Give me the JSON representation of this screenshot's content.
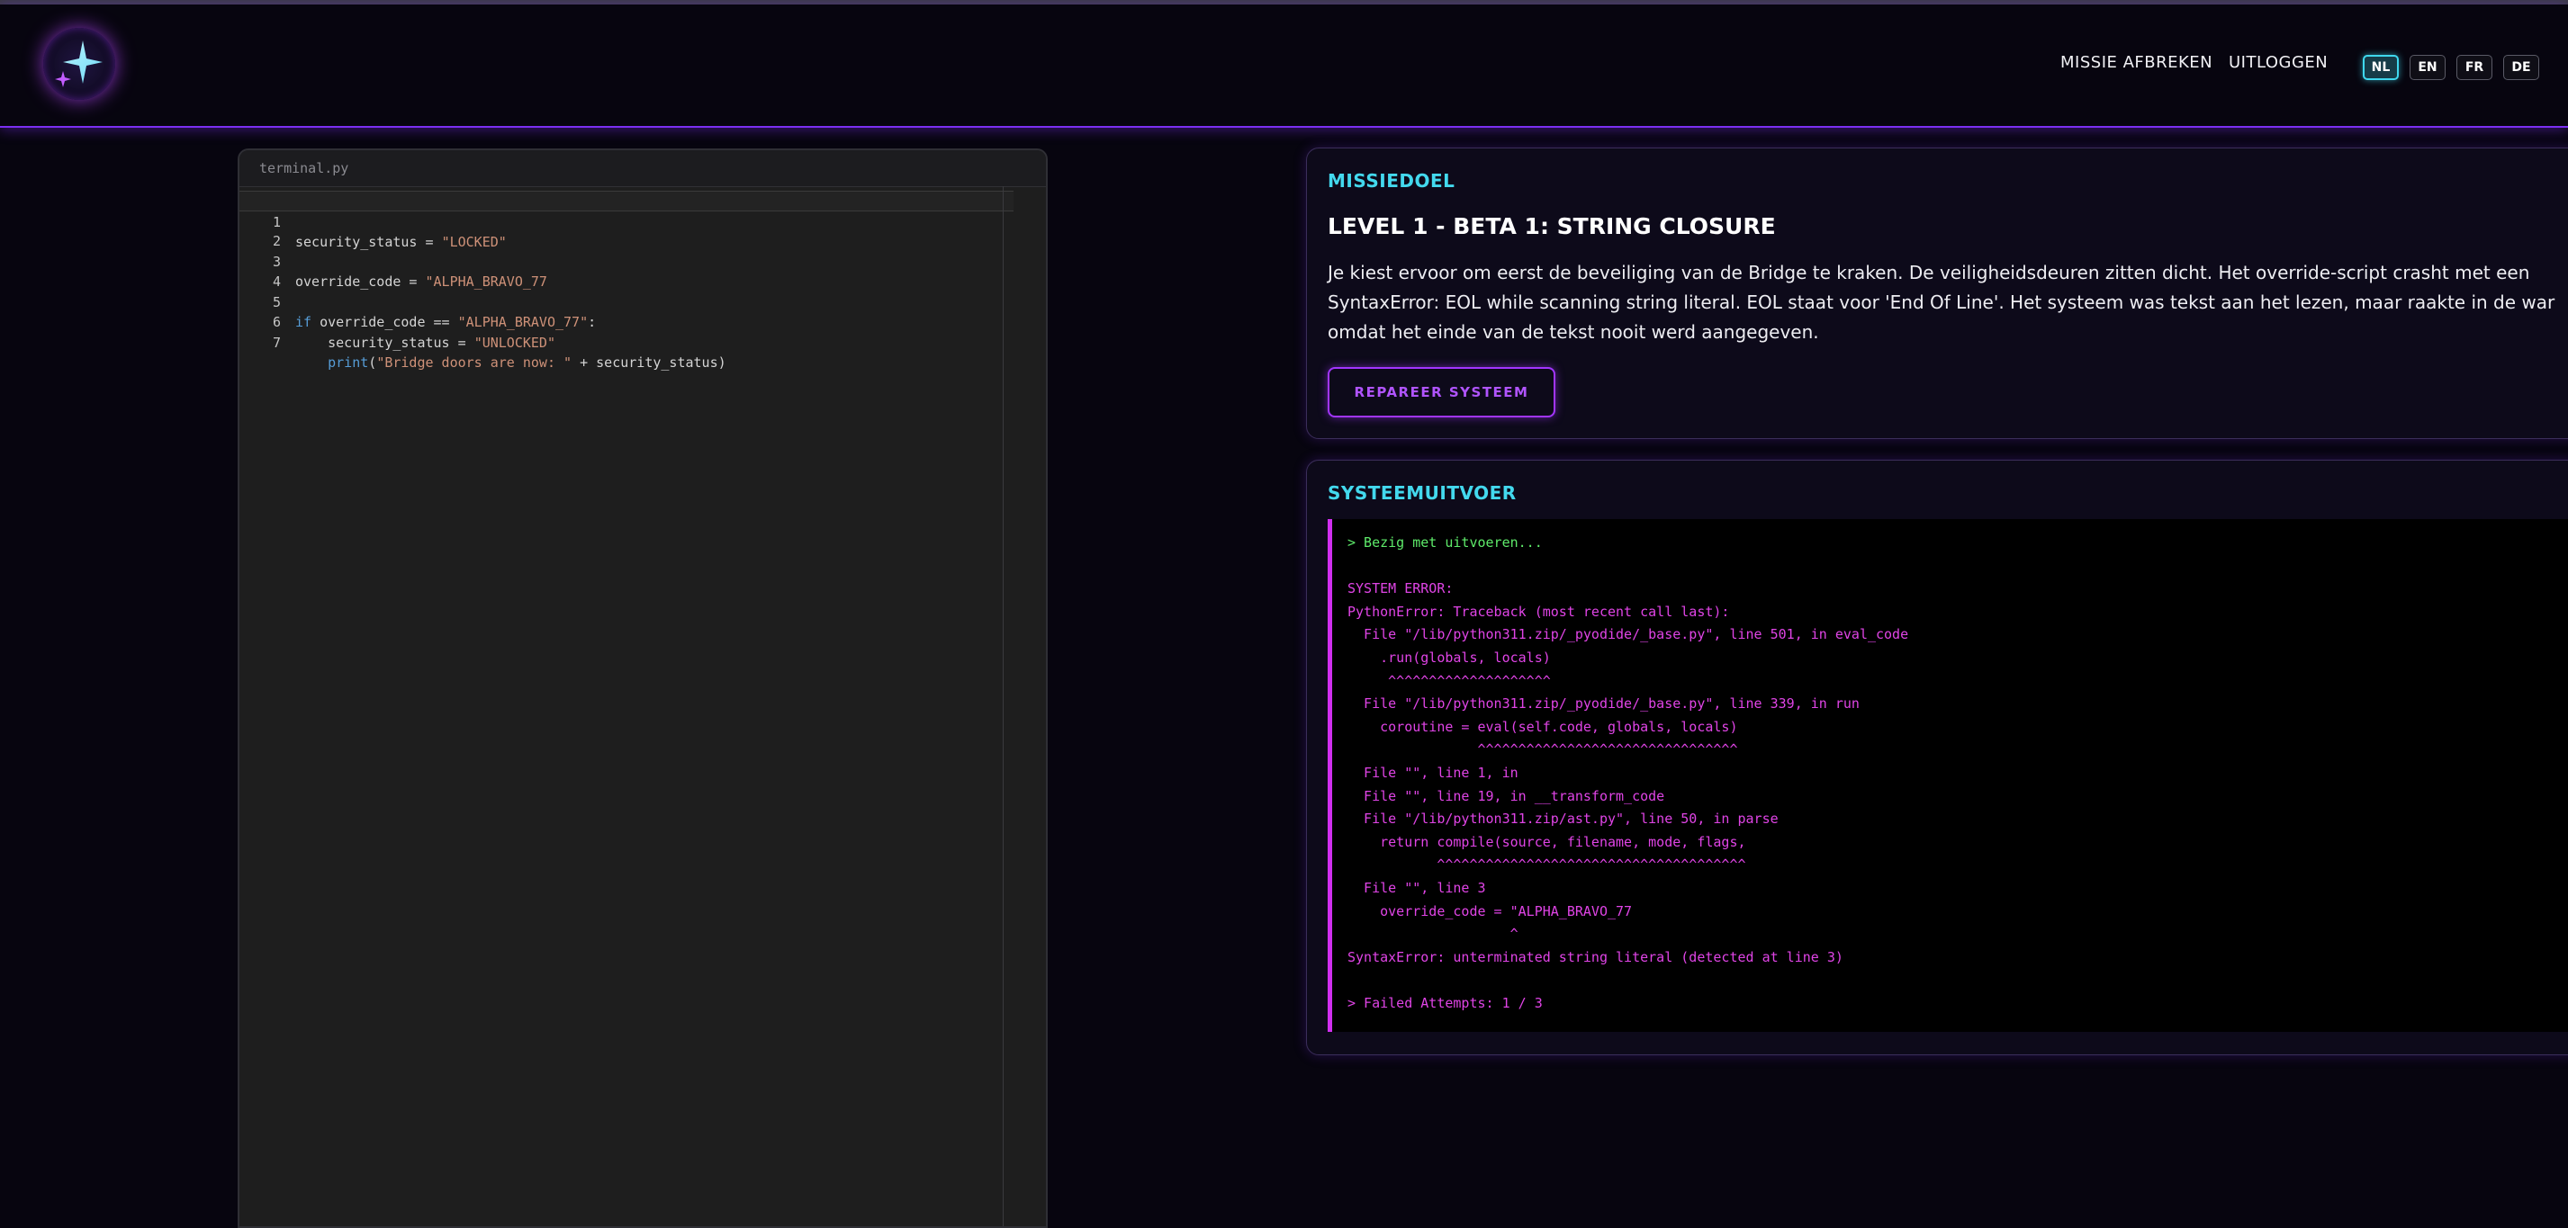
{
  "header": {
    "logo_icon": "sparkle-star-icon",
    "nav": {
      "abort": "MISSIE AFBREKEN",
      "logout": "UITLOGGEN"
    },
    "languages": [
      {
        "code": "NL",
        "active": true
      },
      {
        "code": "EN",
        "active": false
      },
      {
        "code": "FR",
        "active": false
      },
      {
        "code": "DE",
        "active": false
      }
    ]
  },
  "editor": {
    "filename": "terminal.py",
    "lines": [
      {
        "num": "1",
        "text": "security_status = \"LOCKED\""
      },
      {
        "num": "2",
        "text": ""
      },
      {
        "num": "3",
        "text": "override_code = \"ALPHA_BRAVO_77"
      },
      {
        "num": "4",
        "text": ""
      },
      {
        "num": "5",
        "text": "if override_code == \"ALPHA_BRAVO_77\":"
      },
      {
        "num": "6",
        "text": "    security_status = \"UNLOCKED\""
      },
      {
        "num": "7",
        "text": "    print(\"Bridge doors are now: \" + security_status)"
      }
    ]
  },
  "mission": {
    "title": "MISSIEDOEL",
    "level": "LEVEL 1 - BETA 1: STRING CLOSURE",
    "description": "Je kiest ervoor om eerst de beveiliging van de Bridge te kraken. De veiligheidsdeuren zitten dicht. Het override-script crasht met een SyntaxError: EOL while scanning string literal. EOL staat voor 'End Of Line'. Het systeem was tekst aan het lezen, maar raakte in de war omdat het einde van de tekst nooit werd aangegeven.",
    "button": "REPAREER SYSTEEM"
  },
  "output": {
    "title": "SYSTEEMUITVOER",
    "lines": [
      {
        "text": "> Bezig met uitvoeren...",
        "kind": "ok"
      },
      {
        "text": "",
        "kind": "err"
      },
      {
        "text": "SYSTEM ERROR:",
        "kind": "err"
      },
      {
        "text": "PythonError: Traceback (most recent call last):",
        "kind": "err"
      },
      {
        "text": "  File \"/lib/python311.zip/_pyodide/_base.py\", line 501, in eval_code",
        "kind": "err"
      },
      {
        "text": "    .run(globals, locals)",
        "kind": "err"
      },
      {
        "text": "     ^^^^^^^^^^^^^^^^^^^^",
        "kind": "err"
      },
      {
        "text": "  File \"/lib/python311.zip/_pyodide/_base.py\", line 339, in run",
        "kind": "err"
      },
      {
        "text": "    coroutine = eval(self.code, globals, locals)",
        "kind": "err"
      },
      {
        "text": "                ^^^^^^^^^^^^^^^^^^^^^^^^^^^^^^^^",
        "kind": "err"
      },
      {
        "text": "  File \"\", line 1, in",
        "kind": "err"
      },
      {
        "text": "  File \"\", line 19, in __transform_code",
        "kind": "err"
      },
      {
        "text": "  File \"/lib/python311.zip/ast.py\", line 50, in parse",
        "kind": "err"
      },
      {
        "text": "    return compile(source, filename, mode, flags,",
        "kind": "err"
      },
      {
        "text": "           ^^^^^^^^^^^^^^^^^^^^^^^^^^^^^^^^^^^^^^",
        "kind": "err"
      },
      {
        "text": "  File \"\", line 3",
        "kind": "err"
      },
      {
        "text": "    override_code = \"ALPHA_BRAVO_77",
        "kind": "err"
      },
      {
        "text": "                    ^",
        "kind": "err"
      },
      {
        "text": "SyntaxError: unterminated string literal (detected at line 3)",
        "kind": "err"
      },
      {
        "text": "",
        "kind": "err"
      },
      {
        "text": "> Failed Attempts: 1 / 3",
        "kind": "err"
      }
    ]
  },
  "colors": {
    "accent_purple": "#a235ff",
    "accent_cyan": "#43d9ee",
    "error_magenta": "#e044e6",
    "ok_green": "#5eea6a"
  }
}
